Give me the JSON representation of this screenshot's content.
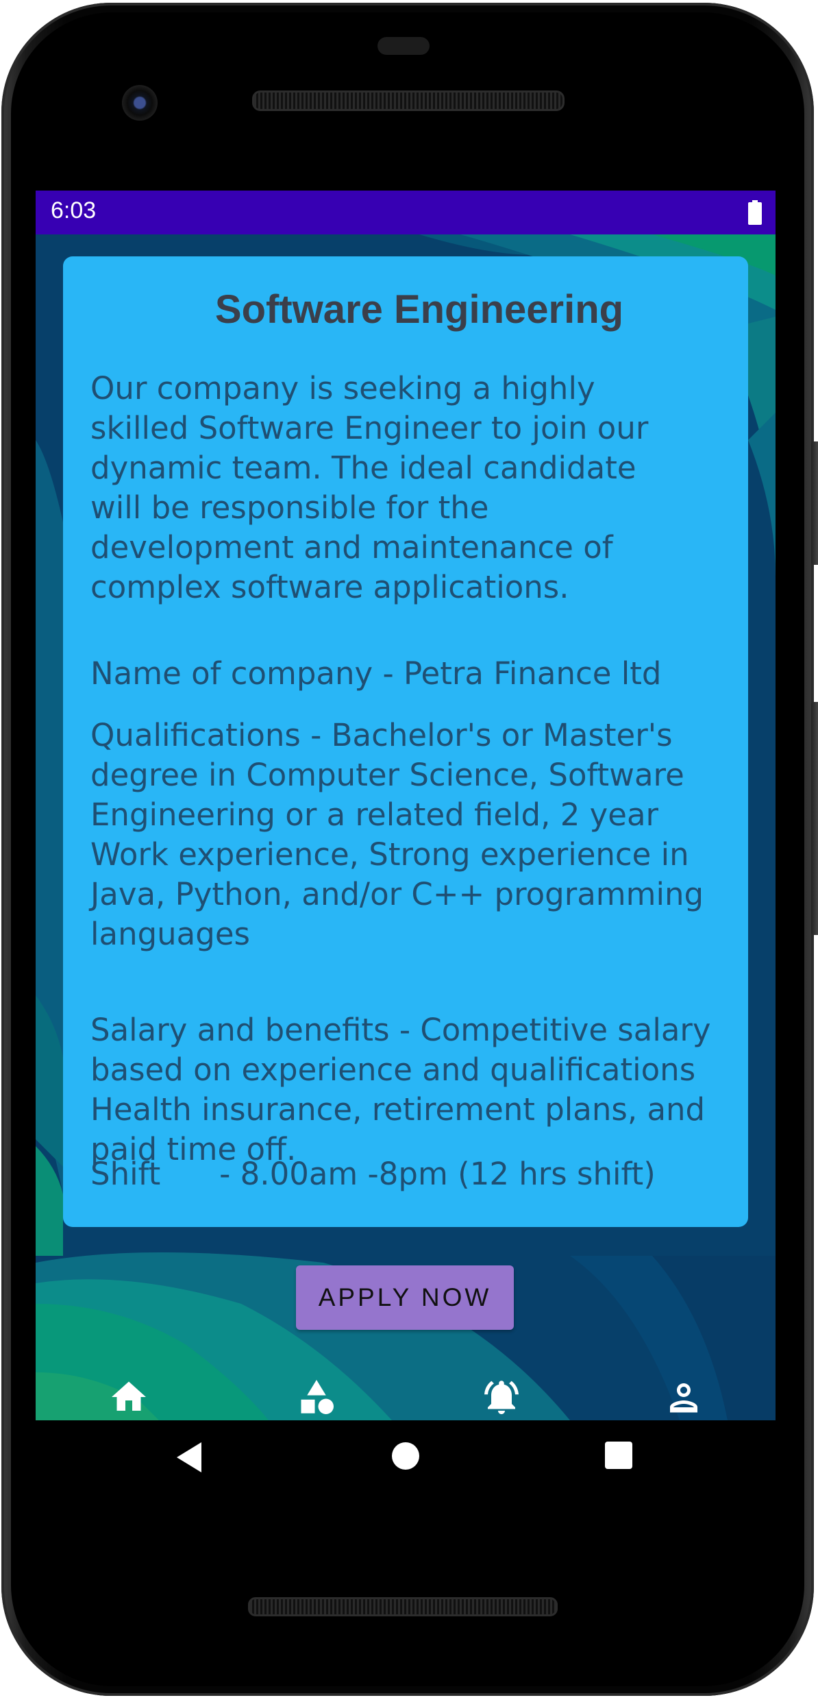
{
  "status_bar": {
    "time": "6:03"
  },
  "card": {
    "title": "Software Engineering",
    "description": "Our company is seeking a highly skilled Software Engineer to join our dynamic team. The ideal candidate will be responsible for the development and maintenance of complex software applications.",
    "company": "Name of company - Petra Finance ltd",
    "qualifications": "Qualifications - Bachelor's or Master's degree in Computer Science, Software Engineering or a related field, 2 year Work experience,  Strong experience in Java, Python, and/or C++ programming languages",
    "salary": "Salary and benefits -     Competitive salary based on experience and qualifications Health insurance, retirement plans, and paid time off.",
    "shift": "Shift      - 8.00am -8pm (12 hrs shift)"
  },
  "apply_button": {
    "label": "APPLY NOW"
  },
  "bottom_nav": {
    "items": [
      {
        "icon": "home-icon"
      },
      {
        "icon": "shapes-icon"
      },
      {
        "icon": "notification-bell-icon"
      },
      {
        "icon": "profile-icon"
      }
    ]
  },
  "system_nav": {
    "buttons": [
      "back",
      "home",
      "recents"
    ]
  },
  "colors": {
    "status_bar": "#3700b3",
    "card": "#29b6f6",
    "card_text": "#1f4f73",
    "title_text": "#3b3f4a",
    "button": "#9575cd"
  }
}
